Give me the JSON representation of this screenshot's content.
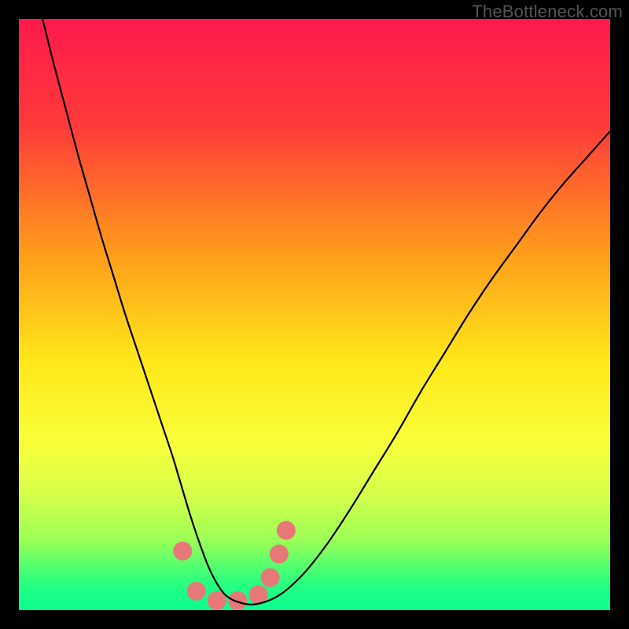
{
  "watermark": "TheBottleneck.com",
  "chart_data": {
    "type": "line",
    "title": "",
    "xlabel": "",
    "ylabel": "",
    "xlim": [
      0,
      100
    ],
    "ylim": [
      0,
      100
    ],
    "gradient_stops": [
      {
        "offset": 0.0,
        "color": "#ff1a4d"
      },
      {
        "offset": 0.18,
        "color": "#ff3a3a"
      },
      {
        "offset": 0.4,
        "color": "#ff9e1a"
      },
      {
        "offset": 0.58,
        "color": "#ffe81a"
      },
      {
        "offset": 0.72,
        "color": "#f8ff3a"
      },
      {
        "offset": 0.8,
        "color": "#d8ff4a"
      },
      {
        "offset": 0.88,
        "color": "#9dff55"
      },
      {
        "offset": 0.945,
        "color": "#35ff7a"
      },
      {
        "offset": 0.972,
        "color": "#1aff88"
      },
      {
        "offset": 1.0,
        "color": "#0bff8f"
      }
    ],
    "series": [
      {
        "name": "bottleneck-curve",
        "x": [
          4,
          6,
          8,
          10,
          12,
          14,
          16,
          18,
          20,
          22,
          24,
          26,
          27.5,
          29,
          30.5,
          32,
          33.5,
          35,
          37,
          40,
          44,
          48,
          52,
          56,
          60,
          64,
          68,
          72,
          76,
          80,
          84,
          88,
          92,
          96,
          100
        ],
        "y": [
          100,
          92,
          84.5,
          77,
          70,
          63,
          56.5,
          50,
          44,
          38,
          32,
          26,
          21,
          16,
          11.5,
          7.5,
          4.5,
          2.5,
          1.4,
          1.0,
          2.5,
          6,
          11,
          17,
          23.5,
          30,
          37,
          43.5,
          50,
          56,
          61.5,
          67,
          72,
          76.5,
          81
        ]
      }
    ],
    "marker_cluster": {
      "name": "highlight-markers",
      "color": "#e77878",
      "points": [
        {
          "x": 27.7,
          "y": 10.0,
          "r": 12
        },
        {
          "x": 30.0,
          "y": 3.2,
          "r": 12
        },
        {
          "x": 33.5,
          "y": 1.6,
          "r": 12
        },
        {
          "x": 37.0,
          "y": 1.6,
          "r": 12
        },
        {
          "x": 40.5,
          "y": 2.6,
          "r": 12
        },
        {
          "x": 42.5,
          "y": 5.5,
          "r": 12
        },
        {
          "x": 44.0,
          "y": 9.5,
          "r": 12
        },
        {
          "x": 45.2,
          "y": 13.5,
          "r": 12
        }
      ]
    }
  }
}
